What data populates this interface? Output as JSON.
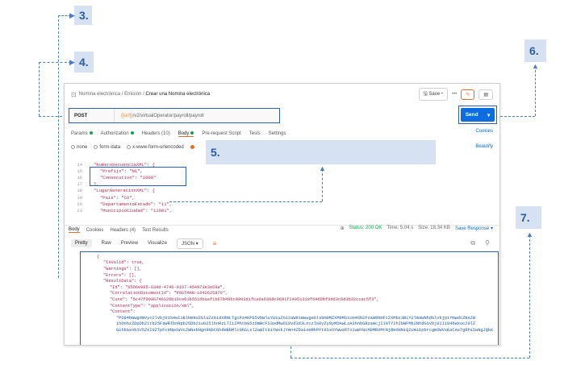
{
  "callouts": [
    "3.",
    "4.",
    "5.",
    "6.",
    "7."
  ],
  "breadcrumb": {
    "parent": "Nomina electrónica",
    "middle": "Emisión",
    "current": "Crear una Nomina electrónica"
  },
  "header": {
    "save_label": "Save",
    "more_label": "•••"
  },
  "request": {
    "method": "POST",
    "url_var": "{{url}}",
    "url_path": "/v2/virtualOperator/payroll/payroll",
    "send_label": "Send"
  },
  "req_tabs": [
    {
      "label": "Params",
      "dot": true
    },
    {
      "label": "Authorization",
      "dot": true
    },
    {
      "label": "Headers (10)",
      "dot": false
    },
    {
      "label": "Body",
      "dot": true,
      "active": true
    },
    {
      "label": "Pre-request Script",
      "dot": false
    },
    {
      "label": "Tests",
      "dot": false
    },
    {
      "label": "Settings",
      "dot": false
    }
  ],
  "cookies_label": "Cookies",
  "body_options": [
    "none",
    "form-data",
    "x-www-form-urlencoded"
  ],
  "beautify_label": "Beautify",
  "editor_lines": [
    {
      "n": "14",
      "t": "\"NumeroSecuenciaXML\": {"
    },
    {
      "n": "15",
      "t": "\"Prefijo\": \"N1\","
    },
    {
      "n": "16",
      "t": "\"Consecutivo\": \"1000\""
    },
    {
      "n": "17",
      "t": "},"
    },
    {
      "n": "18",
      "t": "\"LugarGeneracionXML\": {"
    },
    {
      "n": "19",
      "t": "\"Pais\": \"CO\","
    },
    {
      "n": "20",
      "t": "\"DepartamentoEstado\": \"11\","
    },
    {
      "n": "21",
      "t": "\"MunicipioCiudad\": \"11001\","
    }
  ],
  "resp_tabs": [
    "Body",
    "Cookies",
    "Headers (4)",
    "Test Results"
  ],
  "resp_status": {
    "status": "Status: 200 OK",
    "time": "Time: 5.04 s",
    "size": "Size: 18.34 KB",
    "save": "Save Response"
  },
  "fmt_tabs": [
    "Pretty",
    "Raw",
    "Preview",
    "Visualize",
    "JSON"
  ],
  "json_lines": [
    "{",
    "\"IsValid\": true,",
    "\"Warnings\": [],",
    "\"Errors\": [],",
    "\"ResultData\": {",
    "\"Id\": \"6506e905-634d-4746-9167-454973e3e69a\",",
    "\"CorrelationDocumentId\": \"POSTMAN-1642625870\",",
    "\"Cune\": \"5c47f0096746120b16ce61b551dbaaf1b67b496c0903d1fca6a636dc9691f24951319f64d0bf3dd3c6d3b32ccac5f3\",",
    "\"ContentType\": \"application/xml\",",
    "\"Content\":",
    "\"PD94bWwgdmVyc2lvbj01%4wIiBlbmNvZGluZz0idXRmLTgiPz4KPE5vbWluYU1uZG12aW91WwugeGlsbm0MZXM9MS1cm46b2FzaW9bmFtZXMbc3B1Y2lmaWNhdGlvbjp1YmwdcZNsZW",
    "1hOnhzZDpDb21tb25FaWRlbnRpb25Db21ub25lbnRzLTIiIMhtbG5zOmRcFS3odMwO18vd3d3Lnczle0yZy8yMDAwLzA3hnbGRzaWcjI10TY2hIbWFMb2NhdG1vbj0iIi84bWxuc20lZ",
    "G1hbGxnb3V5ZXI0ZTpFcHNpcWVcZWNsbHgn9NbCGhdHBbMlcGhSLsl2aWIt01YWxkJYmn4ZDa1oHRkPFtKSxOYWwzRTo1wWYWcM9MRXMtNjRHdHNiQ2UmiEpbrcgmDWVxKaCAaTgRPaIwNgJQkK"
  ]
}
